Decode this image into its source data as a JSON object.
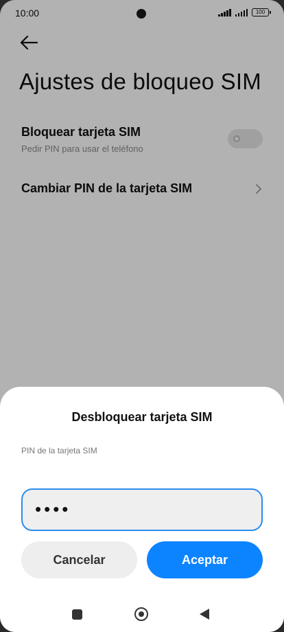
{
  "status_bar": {
    "time": "10:00",
    "battery": "100"
  },
  "page": {
    "title": "Ajustes de bloqueo SIM",
    "lock_sim": {
      "title": "Bloquear tarjeta SIM",
      "subtitle": "Pedir PIN para usar el teléfono",
      "enabled": false
    },
    "change_pin": {
      "title": "Cambiar PIN de la tarjeta SIM"
    }
  },
  "dialog": {
    "title": "Desbloquear tarjeta SIM",
    "field_label": "PIN de la tarjeta SIM",
    "pin_value": "••••",
    "cancel_label": "Cancelar",
    "accept_label": "Aceptar"
  },
  "colors": {
    "accent": "#0d84ff",
    "input_border": "#2b8cf0"
  },
  "icons": {
    "back": "arrow-left-icon",
    "chevron": "chevron-right-icon",
    "nav_recents": "square-icon",
    "nav_home": "home-circle-icon",
    "nav_back": "triangle-back-icon"
  }
}
